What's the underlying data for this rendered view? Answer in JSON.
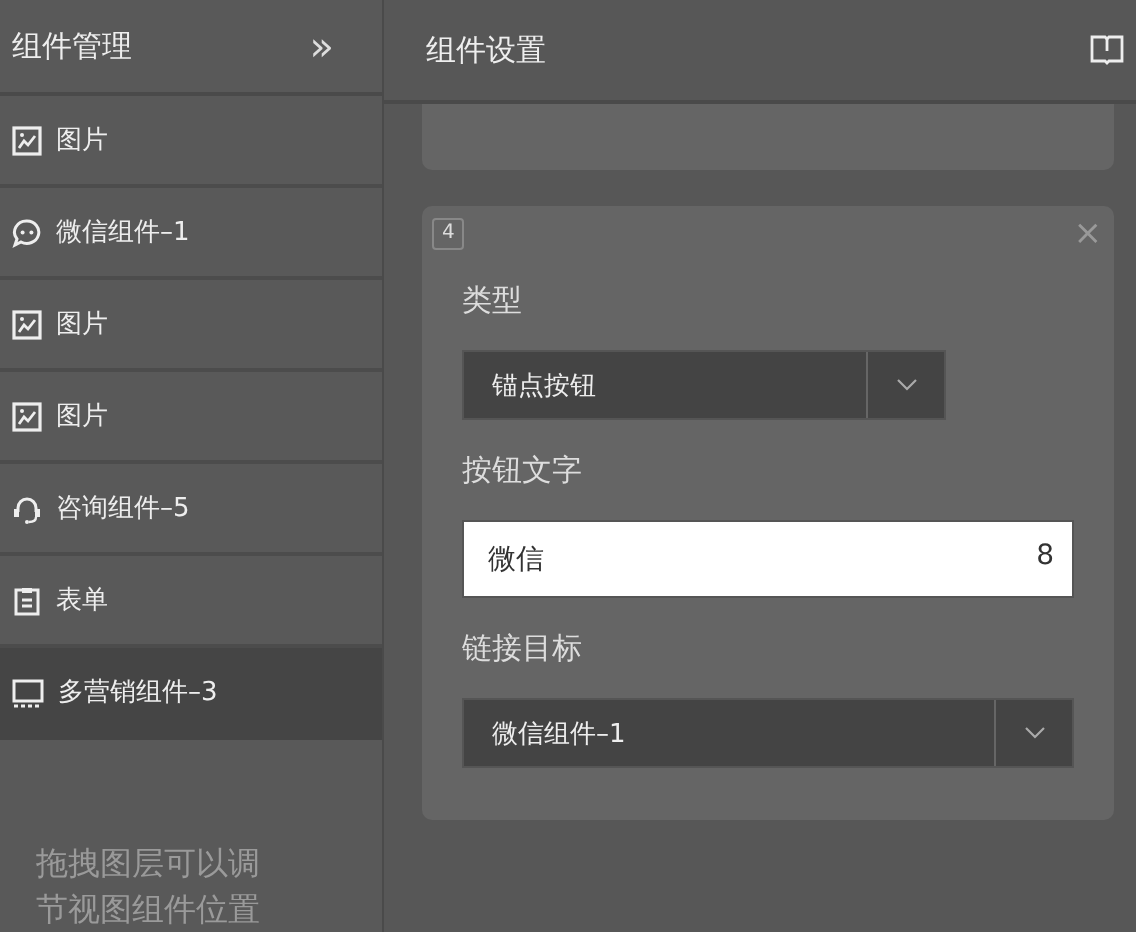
{
  "sidebar": {
    "title": "组件管理",
    "collapse_icon": "»",
    "items": [
      {
        "kind": "image",
        "label": "图片",
        "selected": false
      },
      {
        "kind": "chat",
        "label": "微信组件–1",
        "selected": false
      },
      {
        "kind": "image",
        "label": "图片",
        "selected": false
      },
      {
        "kind": "image",
        "label": "图片",
        "selected": false
      },
      {
        "kind": "headset",
        "label": "咨询组件–5",
        "selected": false
      },
      {
        "kind": "form",
        "label": "表单",
        "selected": false
      },
      {
        "kind": "screen",
        "label": "多营销组件–3",
        "selected": true
      }
    ],
    "hint": "拖拽图层可以调节视图组件位置"
  },
  "settings": {
    "title": "组件设置",
    "card": {
      "badge": "4",
      "close": "×",
      "fields": [
        {
          "kind": "select",
          "label": "类型",
          "value": "锚点按钮",
          "narrow": true
        },
        {
          "kind": "input",
          "label": "按钮文字",
          "value": "微信",
          "count": "8"
        },
        {
          "kind": "select",
          "label": "链接目标",
          "value": "微信组件–1",
          "narrow": false
        }
      ]
    }
  }
}
